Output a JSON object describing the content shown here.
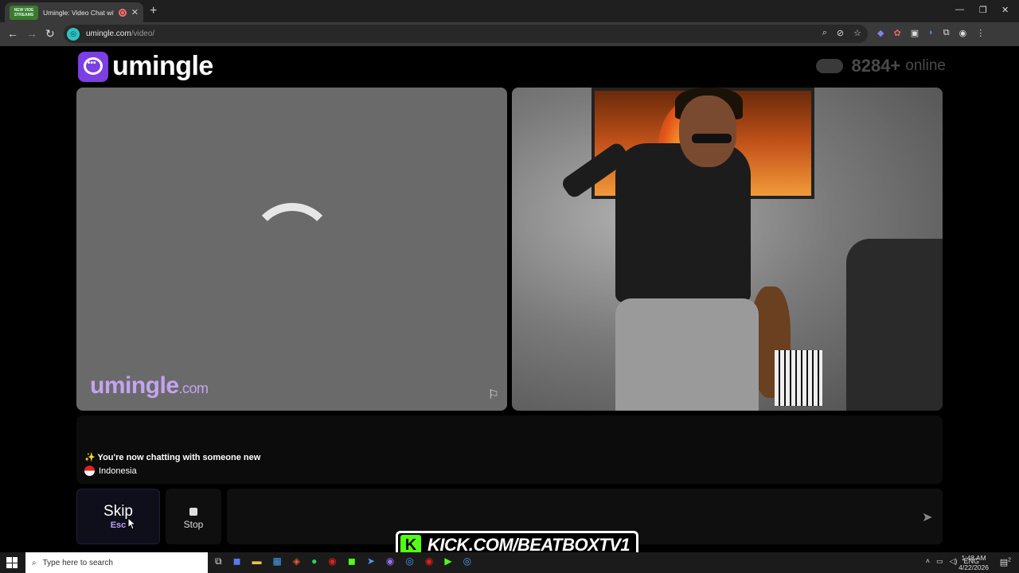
{
  "browser": {
    "tab": {
      "favicon_text": "NEW VIDE STREAMS",
      "title": "Umingle: Video Chat with S"
    },
    "url_host": "umingle.com",
    "url_path": "/video/"
  },
  "site": {
    "logo": "umingle",
    "online_count": "8284+",
    "online_label": "online"
  },
  "video_left": {
    "watermark_main": "umingle",
    "watermark_tld": ".com"
  },
  "chat": {
    "status_message": "✨ You're now chatting with someone new",
    "country": "Indonesia"
  },
  "controls": {
    "skip_label": "Skip",
    "skip_key": "Esc",
    "stop_label": "Stop",
    "message_placeholder": ""
  },
  "overlay": {
    "kick_text": "KICK.COM/BEATBOXTV1"
  },
  "taskbar": {
    "search_placeholder": "Type here to search",
    "language": "ENG",
    "time": "1:48 AM",
    "date": "4/22/2026",
    "notification_count": "2"
  },
  "colors": {
    "brand_purple": "#7b3fe4",
    "watermark_purple": "#c3a4f0",
    "kick_green": "#53fc18"
  }
}
